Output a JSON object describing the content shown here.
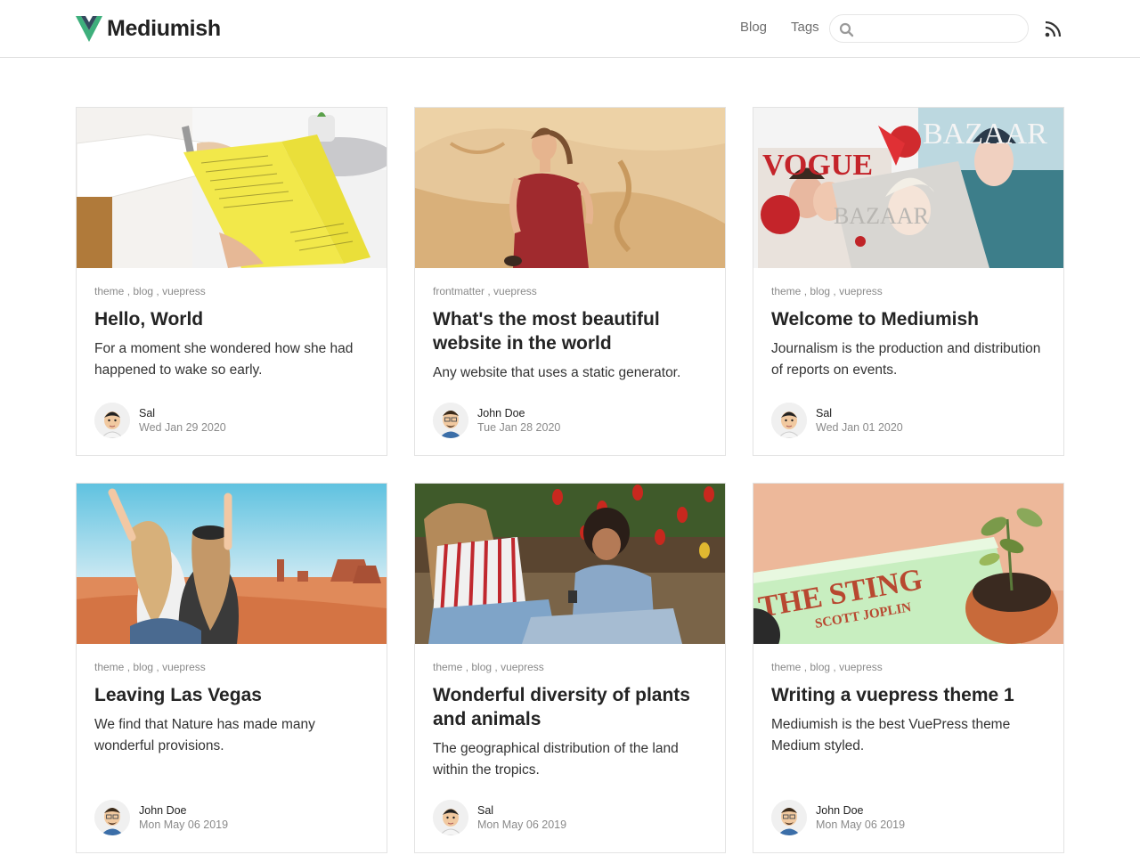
{
  "header": {
    "brand": "Mediumish",
    "nav": {
      "blog": "Blog",
      "tags": "Tags"
    },
    "search_value": "",
    "brand_color": "#3eaf7c"
  },
  "posts": [
    {
      "tags": [
        "theme",
        "blog",
        "vuepress"
      ],
      "title": "Hello, World",
      "excerpt": "For a moment she wondered how she had happened to wake so early.",
      "author": "Sal",
      "date": "Wed Jan 29 2020"
    },
    {
      "tags": [
        "frontmatter",
        "vuepress"
      ],
      "title": "What's the most beautiful website in the world",
      "excerpt": "Any website that uses a static generator.",
      "author": "John Doe",
      "date": "Tue Jan 28 2020"
    },
    {
      "tags": [
        "theme",
        "blog",
        "vuepress"
      ],
      "title": "Welcome to Mediumish",
      "excerpt": "Journalism is the production and distribution of reports on events.",
      "author": "Sal",
      "date": "Wed Jan 01 2020"
    },
    {
      "tags": [
        "theme",
        "blog",
        "vuepress"
      ],
      "title": "Leaving Las Vegas",
      "excerpt": "We find that Nature has made many wonderful provisions.",
      "author": "John Doe",
      "date": "Mon May 06 2019"
    },
    {
      "tags": [
        "theme",
        "blog",
        "vuepress"
      ],
      "title": "Wonderful diversity of plants and animals",
      "excerpt": "The geographical distribution of the land within the tropics.",
      "author": "Sal",
      "date": "Mon May 06 2019"
    },
    {
      "tags": [
        "theme",
        "blog",
        "vuepress"
      ],
      "title": "Writing a vuepress theme 1",
      "excerpt": "Mediumish is the best VuePress theme Medium styled.",
      "author": "John Doe",
      "date": "Mon May 06 2019"
    }
  ]
}
